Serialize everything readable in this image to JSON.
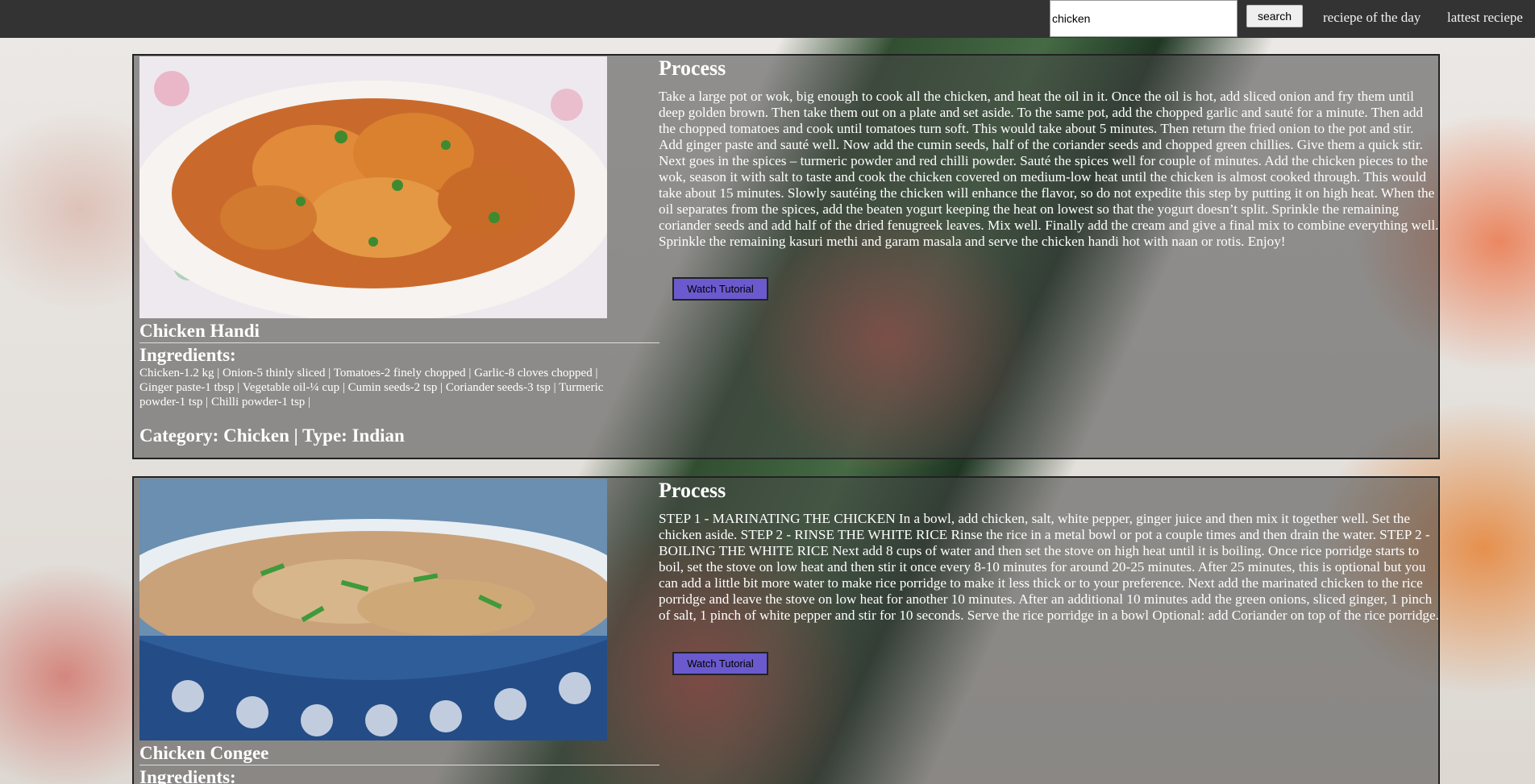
{
  "nav": {
    "search_value": "chicken",
    "search_button": "search",
    "links": [
      "reciepe of the day",
      "lattest reciepe"
    ]
  },
  "recipes": [
    {
      "title": "Chicken Handi",
      "ingredients_heading": "Ingredients:",
      "ingredients": "Chicken-1.2 kg | Onion-5 thinly sliced | Tomatoes-2 finely chopped | Garlic-8 cloves chopped | Ginger paste-1 tbsp | Vegetable oil-¼ cup | Cumin seeds-2 tsp | Coriander seeds-3 tsp | Turmeric powder-1 tsp | Chilli powder-1 tsp |",
      "meta": "Category: Chicken | Type: Indian",
      "process_heading": "Process",
      "process": "Take a large pot or wok, big enough to cook all the chicken, and heat the oil in it. Once the oil is hot, add sliced onion and fry them until deep golden brown. Then take them out on a plate and set aside. To the same pot, add the chopped garlic and sauté for a minute. Then add the chopped tomatoes and cook until tomatoes turn soft. This would take about 5 minutes. Then return the fried onion to the pot and stir. Add ginger paste and sauté well. Now add the cumin seeds, half of the coriander seeds and chopped green chillies. Give them a quick stir. Next goes in the spices – turmeric powder and red chilli powder. Sauté the spices well for couple of minutes. Add the chicken pieces to the wok, season it with salt to taste and cook the chicken covered on medium-low heat until the chicken is almost cooked through. This would take about 15 minutes. Slowly sautéing the chicken will enhance the flavor, so do not expedite this step by putting it on high heat. When the oil separates from the spices, add the beaten yogurt keeping the heat on lowest so that the yogurt doesn’t split. Sprinkle the remaining coriander seeds and add half of the dried fenugreek leaves. Mix well. Finally add the cream and give a final mix to combine everything well. Sprinkle the remaining kasuri methi and garam masala and serve the chicken handi hot with naan or rotis. Enjoy!",
      "tutorial_button": "Watch Tutorial"
    },
    {
      "title": "Chicken Congee",
      "ingredients_heading": "Ingredients:",
      "process_heading": "Process",
      "process": "STEP 1 - MARINATING THE CHICKEN In a bowl, add chicken, salt, white pepper, ginger juice and then mix it together well. Set the chicken aside. STEP 2 - RINSE THE WHITE RICE Rinse the rice in a metal bowl or pot a couple times and then drain the water. STEP 2 - BOILING THE WHITE RICE Next add 8 cups of water and then set the stove on high heat until it is boiling. Once rice porridge starts to boil, set the stove on low heat and then stir it once every 8-10 minutes for around 20-25 minutes. After 25 minutes, this is optional but you can add a little bit more water to make rice porridge to make it less thick or to your preference. Next add the marinated chicken to the rice porridge and leave the stove on low heat for another 10 minutes. After an additional 10 minutes add the green onions, sliced ginger, 1 pinch of salt, 1 pinch of white pepper and stir for 10 seconds. Serve the rice porridge in a bowl Optional: add Coriander on top of the rice porridge.",
      "tutorial_button": "Watch Tutorial"
    }
  ]
}
